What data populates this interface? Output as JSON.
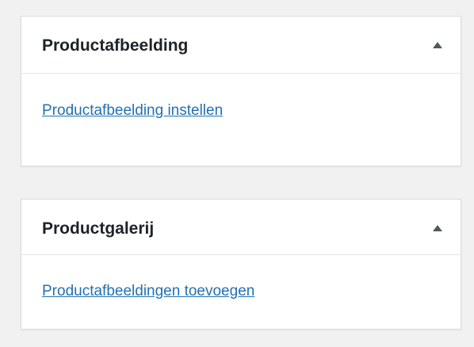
{
  "panels": {
    "product_image": {
      "title": "Productafbeelding",
      "link": "Productafbeelding instellen",
      "toggle_icon": "triangle-up-icon"
    },
    "product_gallery": {
      "title": "Productgalerij",
      "link": "Productafbeeldingen toevoegen",
      "toggle_icon": "triangle-up-icon"
    }
  },
  "colors": {
    "background": "#f1f1f1",
    "panel": "#ffffff",
    "border": "#dcdcde",
    "title": "#1d2327",
    "link": "#2271b1",
    "toggle": "#50575e"
  }
}
